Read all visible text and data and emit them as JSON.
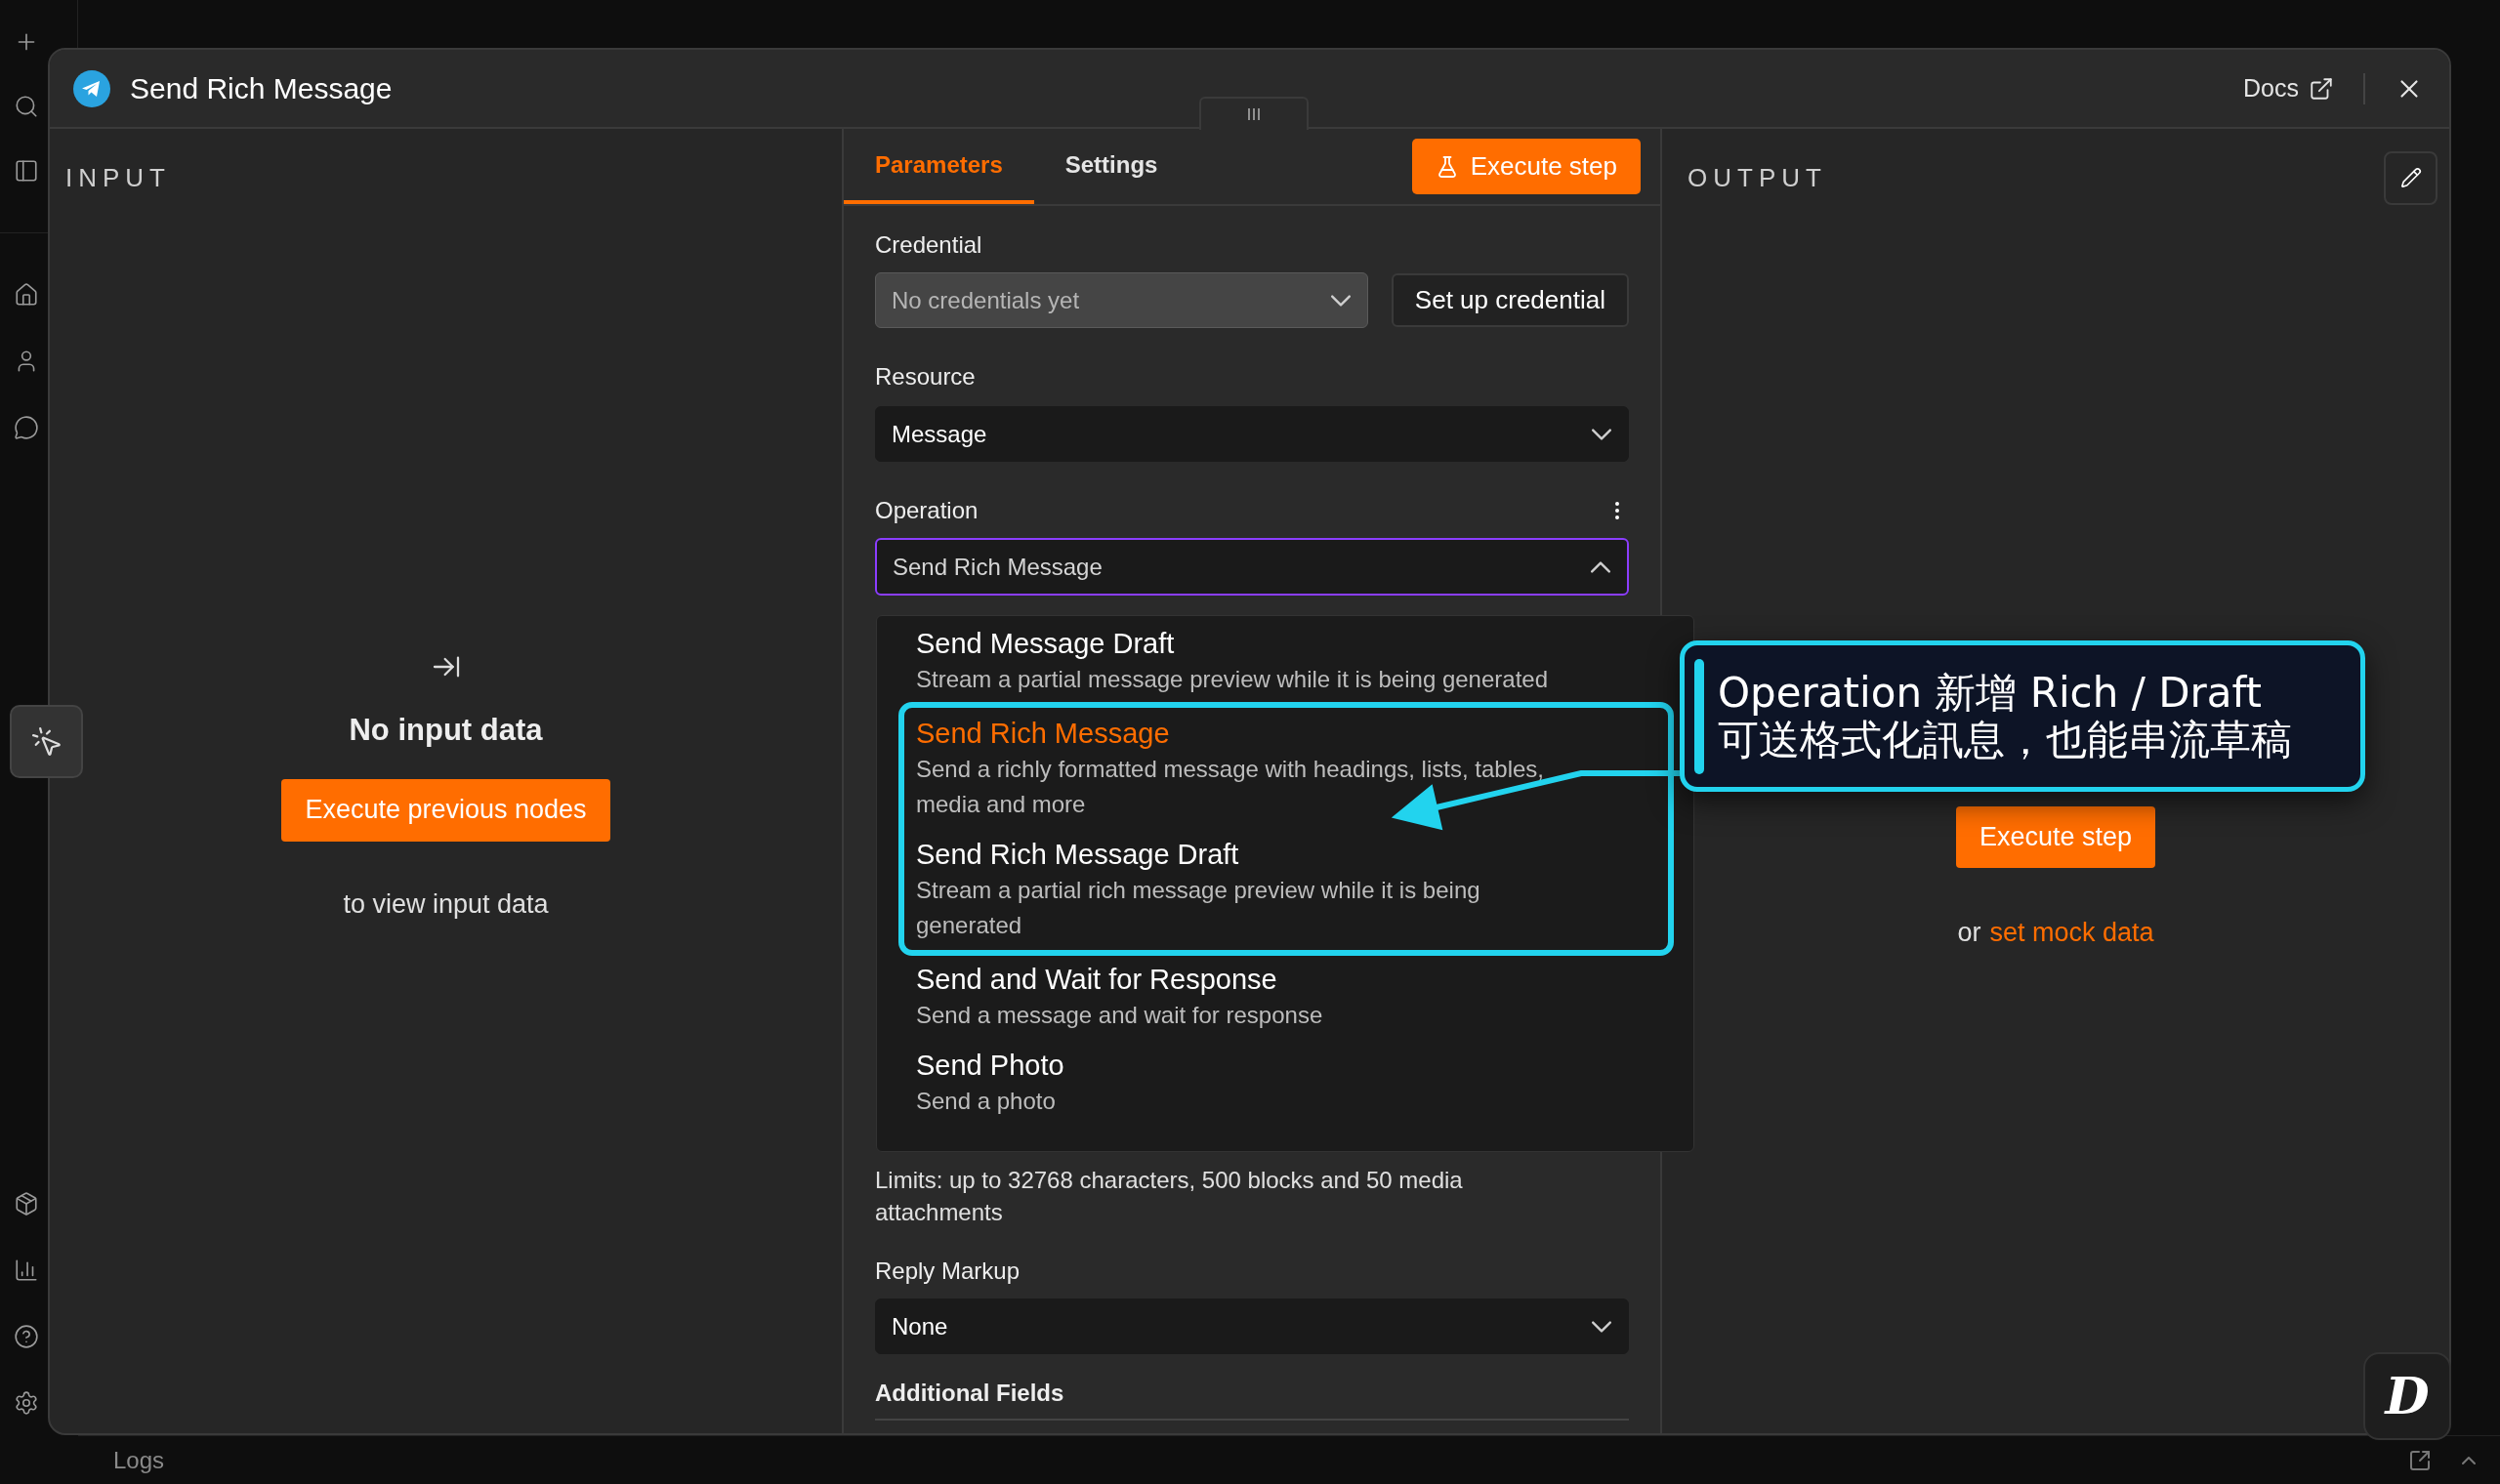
{
  "window": {
    "title": "Send Rich Message",
    "docs_link": "Docs"
  },
  "input_panel": {
    "heading": "INPUT",
    "message": "No input data",
    "button": "Execute previous nodes",
    "hint": "to view input data"
  },
  "parameters_panel": {
    "tabs": [
      {
        "label": "Parameters",
        "selected": true
      },
      {
        "label": "Settings",
        "selected": false
      }
    ],
    "execute_button": "Execute step",
    "credential": {
      "label": "Credential",
      "placeholder": "No credentials yet",
      "button": "Set up credential"
    },
    "resource": {
      "label": "Resource",
      "value": "Message"
    },
    "operation": {
      "label": "Operation",
      "value": "Send Rich Message",
      "expanded": true,
      "options": [
        {
          "title": "Send Message Draft",
          "description": "Stream a partial message preview while it is being generated",
          "selected": false,
          "highlighted": false
        },
        {
          "title": "Send Rich Message",
          "description": "Send a richly formatted message with headings, lists, tables, media and more",
          "selected": true,
          "highlighted": true
        },
        {
          "title": "Send Rich Message Draft",
          "description": "Stream a partial rich message preview while it is being generated",
          "selected": false,
          "highlighted": true
        },
        {
          "title": "Send and Wait for Response",
          "description": "Send a message and wait for response",
          "selected": false,
          "highlighted": false
        },
        {
          "title": "Send Photo",
          "description": "Send a photo",
          "selected": false,
          "highlighted": false
        }
      ]
    },
    "limits_note": "Limits: up to 32768 characters, 500 blocks and 50 media attachments",
    "reply_markup": {
      "label": "Reply Markup",
      "value": "None"
    },
    "additional_fields": "Additional Fields"
  },
  "output_panel": {
    "heading": "OUTPUT",
    "button": "Execute step",
    "hint_prefix": "or",
    "hint_link": "set mock data"
  },
  "annotation": {
    "lines": [
      "Operation 新增 Rich / Draft",
      "可送格式化訊息，也能串流草稿"
    ]
  },
  "corner_badge": {
    "letter": "D"
  },
  "bottom_bar": {
    "label": "Logs"
  }
}
